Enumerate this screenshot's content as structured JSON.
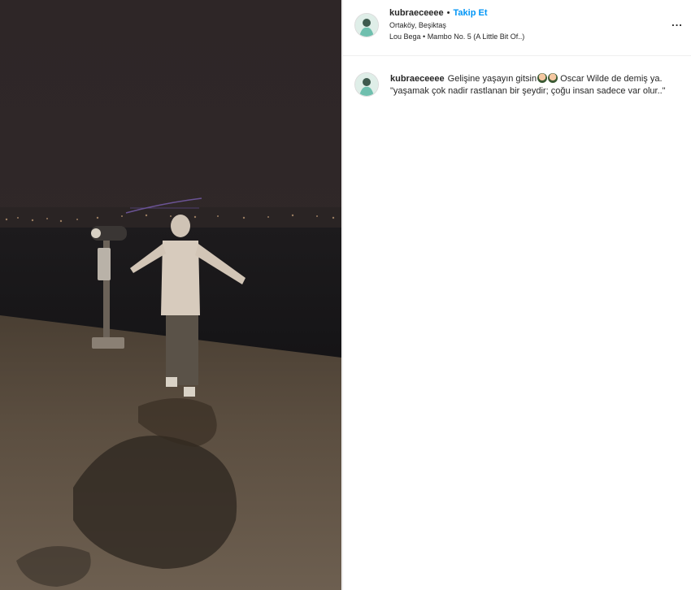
{
  "media": {
    "description_icon": "video-media"
  },
  "header": {
    "username": "kubraeceeee",
    "separator": "•",
    "follow_label": "Takip Et",
    "location": "Ortaköy, Beşiktaş",
    "music": "Lou Bega • Mambo No. 5 (A Little Bit Of..)",
    "more_icon": "more-horizontal-icon",
    "more_label": "..."
  },
  "caption": {
    "username": "kubraeceeee",
    "text_part1": "Gelişine yaşayın gitsin",
    "emoji_name": "woman-emoji",
    "text_part2": " Oscar Wilde de demiş ya. \"yaşamak çok nadir rastlanan bir şeydir; çoğu insan sadece var olur..\""
  },
  "colors": {
    "accent": "#0095f6",
    "text": "#262626",
    "background": "#ffffff",
    "night_sky": "#2b2526"
  }
}
